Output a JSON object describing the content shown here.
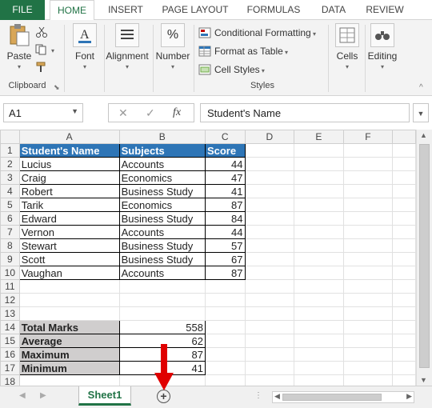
{
  "ribbon": {
    "tabs": [
      "FILE",
      "HOME",
      "INSERT",
      "PAGE LAYOUT",
      "FORMULAS",
      "DATA",
      "REVIEW"
    ],
    "active_tab": "HOME",
    "clipboard": {
      "paste_label": "Paste",
      "group_label": "Clipboard"
    },
    "font_label": "Font",
    "alignment_label": "Alignment",
    "number_label": "Number",
    "styles": {
      "conditional_formatting": "Conditional Formatting",
      "format_as_table": "Format as Table",
      "cell_styles": "Cell Styles",
      "group_label": "Styles"
    },
    "cells_label": "Cells",
    "editing_label": "Editing"
  },
  "formula_bar": {
    "name_box": "A1",
    "fx": "fx",
    "content": "Student's Name"
  },
  "grid": {
    "columns": [
      "A",
      "B",
      "C",
      "D",
      "E",
      "F"
    ],
    "headers": [
      "Student's Name",
      "Subjects",
      "Score"
    ],
    "rows": [
      [
        "Lucius",
        "Accounts",
        "44"
      ],
      [
        "Craig",
        "Economics",
        "47"
      ],
      [
        "Robert",
        "Business Study",
        "41"
      ],
      [
        "Tarik",
        "Economics",
        "87"
      ],
      [
        "Edward",
        "Business Study",
        "84"
      ],
      [
        "Vernon",
        "Accounts",
        "44"
      ],
      [
        "Stewart",
        "Business Study",
        "57"
      ],
      [
        "Scott",
        "Business Study",
        "67"
      ],
      [
        "Vaughan",
        "Accounts",
        "87"
      ]
    ],
    "summary": [
      [
        "Total Marks",
        "558"
      ],
      [
        "Average",
        "62"
      ],
      [
        "Maximum",
        "87"
      ],
      [
        "Minimum",
        "41"
      ]
    ],
    "row_numbers": [
      "1",
      "2",
      "3",
      "4",
      "5",
      "6",
      "7",
      "8",
      "9",
      "10",
      "11",
      "12",
      "13",
      "14",
      "15",
      "16",
      "17",
      "18"
    ]
  },
  "sheets": {
    "tabs": [
      "Sheet1"
    ],
    "active": "Sheet1",
    "add_label": "+"
  },
  "colors": {
    "excel_green": "#217346",
    "header_blue": "#2e75b6",
    "summary_gray": "#d0cece",
    "arrow_red": "#e00000"
  }
}
